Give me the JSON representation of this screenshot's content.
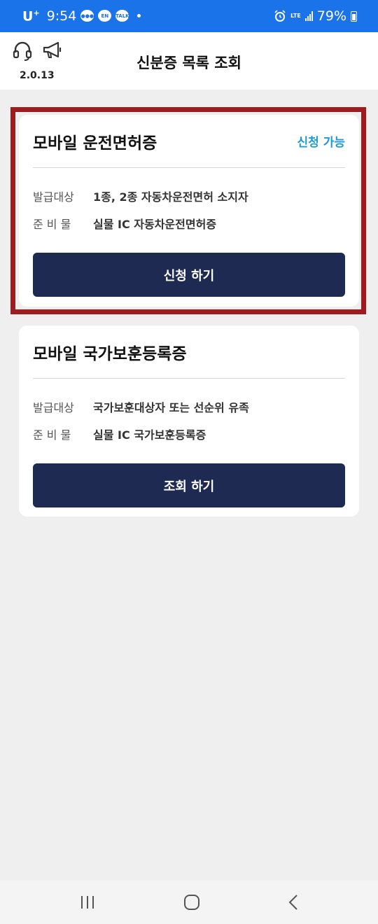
{
  "status_bar": {
    "carrier": "U",
    "carrier_sup": "+",
    "time": "9:54",
    "notif_badges": [
      "EN",
      "TALK"
    ],
    "network": "LTE",
    "battery": "79%"
  },
  "header": {
    "title": "신분증 목록 조회",
    "version": "2.0.13",
    "icons": [
      "headset-icon",
      "megaphone-icon"
    ]
  },
  "cards": [
    {
      "title": "모바일 운전면허증",
      "status": "신청 가능",
      "issue_label": "발급대상",
      "issue_value": "1종, 2종 자동차운전면허 소지자",
      "prep_label": "준 비 물",
      "prep_value": "실물 IC 자동차운전면허증",
      "button": "신청 하기"
    },
    {
      "title": "모바일 국가보훈등록증",
      "issue_label": "발급대상",
      "issue_value": "국가보훈대상자 또는 선순위 유족",
      "prep_label": "준 비 물",
      "prep_value": "실물 IC 국가보훈등록증",
      "button": "조회 하기"
    }
  ],
  "colors": {
    "status_bar": "#1a73e8",
    "button": "#1f2a52",
    "status_text": "#1e9bd6",
    "highlight": "#9e1b1f"
  }
}
